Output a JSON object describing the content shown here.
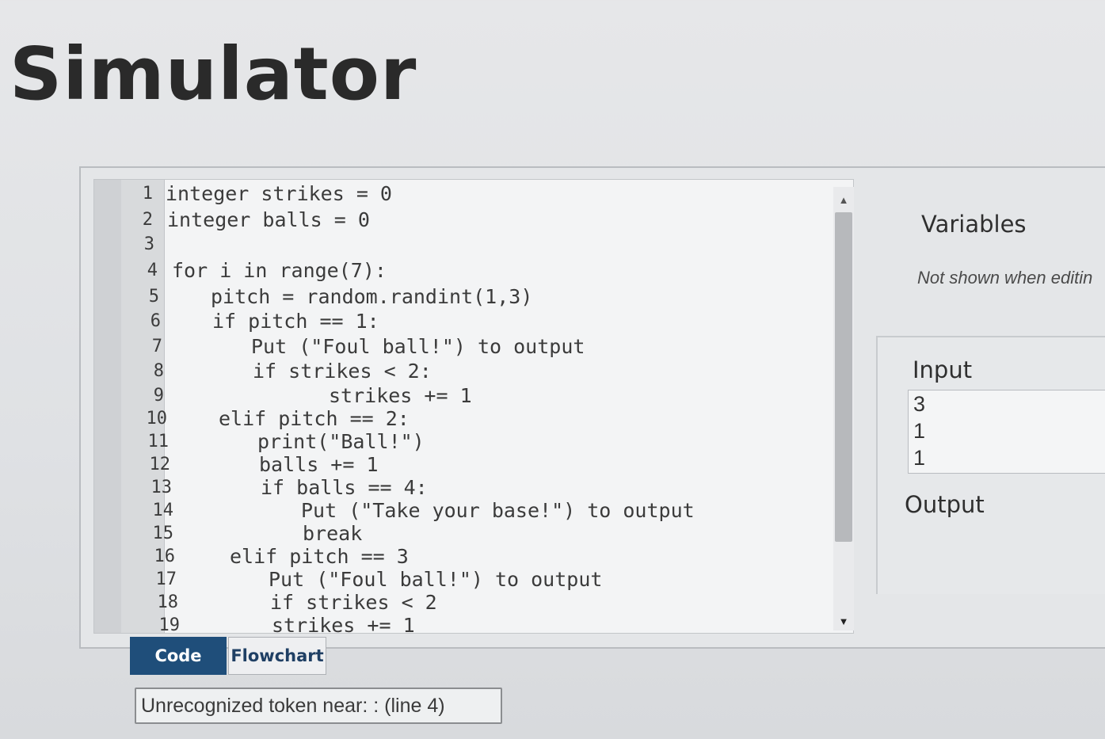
{
  "page": {
    "title": "Simulator"
  },
  "editor": {
    "lines": [
      {
        "num": "1",
        "text": "integer strikes = 0"
      },
      {
        "num": "2",
        "text": "integer balls = 0"
      },
      {
        "num": "3",
        "text": ""
      },
      {
        "num": "4",
        "text": "for i in range(7):"
      },
      {
        "num": "5",
        "text": "pitch = random.randint(1,3)"
      },
      {
        "num": "6",
        "text": "if pitch == 1:"
      },
      {
        "num": "7",
        "text": "Put (\"Foul ball!\") to output"
      },
      {
        "num": "8",
        "text": "if strikes < 2:"
      },
      {
        "num": "9",
        "text": "strikes += 1"
      },
      {
        "num": "10",
        "text": "elif pitch == 2:"
      },
      {
        "num": "11",
        "text": "print(\"Ball!\")"
      },
      {
        "num": "12",
        "text": "balls += 1"
      },
      {
        "num": "13",
        "text": "if balls == 4:"
      },
      {
        "num": "14",
        "text": "Put (\"Take your base!\") to output"
      },
      {
        "num": "15",
        "text": "break"
      },
      {
        "num": "16",
        "text": "elif pitch == 3"
      },
      {
        "num": "17",
        "text": "Put (\"Foul ball!\") to output"
      },
      {
        "num": "18",
        "text": "if strikes < 2"
      },
      {
        "num": "19",
        "text": "strikes += 1"
      }
    ]
  },
  "tabs": {
    "code": "Code",
    "flowchart": "Flowchart"
  },
  "error": {
    "message": "Unrecognized token near: :  (line 4)"
  },
  "variables": {
    "label": "Variables",
    "note": "Not shown when editin"
  },
  "input": {
    "label": "Input",
    "values": [
      "3",
      "1",
      "1"
    ]
  },
  "output": {
    "label": "Output",
    "value": ""
  },
  "icons": {
    "scroll_up": "triangle-up-icon",
    "scroll_down": "triangle-down-icon"
  },
  "colors": {
    "active_tab": "#1f4e7a",
    "page_bg": "#e2e4e6"
  }
}
